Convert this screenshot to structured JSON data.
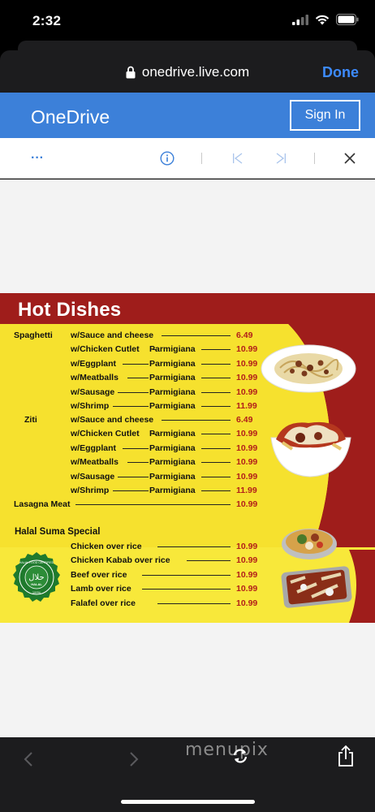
{
  "status_bar": {
    "time": "2:32"
  },
  "safari": {
    "url": "onedrive.live.com",
    "done_label": "Done"
  },
  "onedrive": {
    "title": "OneDrive",
    "sign_in_label": "Sign In"
  },
  "toolbar": {
    "more_label": "···"
  },
  "menu": {
    "title": "Hot Dishes",
    "sections": {
      "spaghetti": "Spaghetti",
      "ziti": "Ziti",
      "lasagna": "Lasagna Meat",
      "lasagna_price": "10.99",
      "halal": "Halal Suma Special"
    },
    "spaghetti_items": [
      {
        "name": "w/Sauce and cheese",
        "style": "",
        "price": "6.49"
      },
      {
        "name": "w/Chicken Cutlet",
        "style": "Parmigiana",
        "price": "10.99"
      },
      {
        "name": "w/Eggplant",
        "style": "Parmigiana",
        "price": "10.99"
      },
      {
        "name": "w/Meatballs",
        "style": "Parmigiana",
        "price": "10.99"
      },
      {
        "name": "w/Sausage",
        "style": "Parmigiana",
        "price": "10.99"
      },
      {
        "name": "w/Shrimp",
        "style": "Parmigiana",
        "price": "11.99"
      }
    ],
    "ziti_items": [
      {
        "name": "w/Sauce and cheese",
        "style": "",
        "price": "6.49"
      },
      {
        "name": "w/Chicken Cutlet",
        "style": "Parmigiana",
        "price": "10.99"
      },
      {
        "name": "w/Eggplant",
        "style": "Parmigiana",
        "price": "10.99"
      },
      {
        "name": "w/Meatballs",
        "style": "Parmigiana",
        "price": "10.99"
      },
      {
        "name": "w/Sausage",
        "style": "Parmigiana",
        "price": "10.99"
      },
      {
        "name": "w/Shrimp",
        "style": "Parmigiana",
        "price": "11.99"
      }
    ],
    "halal_items": [
      {
        "name": "Chicken over rice",
        "price": "10.99"
      },
      {
        "name": "Chicken Kabab over rice",
        "price": "10.99"
      },
      {
        "name": "Beef over rice",
        "price": "10.99"
      },
      {
        "name": "Lamb over rice",
        "price": "10.99"
      },
      {
        "name": "Falafel over rice",
        "price": "10.99"
      }
    ],
    "badge": {
      "top": "HALAL FOOD CERTIFIED",
      "arabic": "حلال",
      "mid": "HALAL",
      "bottom": "100%"
    }
  },
  "watermark": "menupix",
  "colors": {
    "onedrive_blue": "#3c80d9",
    "menu_red": "#9f1d1b",
    "menu_yellow": "#f8e83a",
    "price_red": "#b21e1a",
    "safari_blue": "#3d8bff"
  },
  "icons": [
    "lock-icon",
    "info-icon",
    "first-page-icon",
    "last-page-icon",
    "close-icon",
    "back-icon",
    "forward-icon",
    "refresh-icon",
    "share-icon",
    "signal-icon",
    "wifi-icon",
    "battery-icon"
  ]
}
